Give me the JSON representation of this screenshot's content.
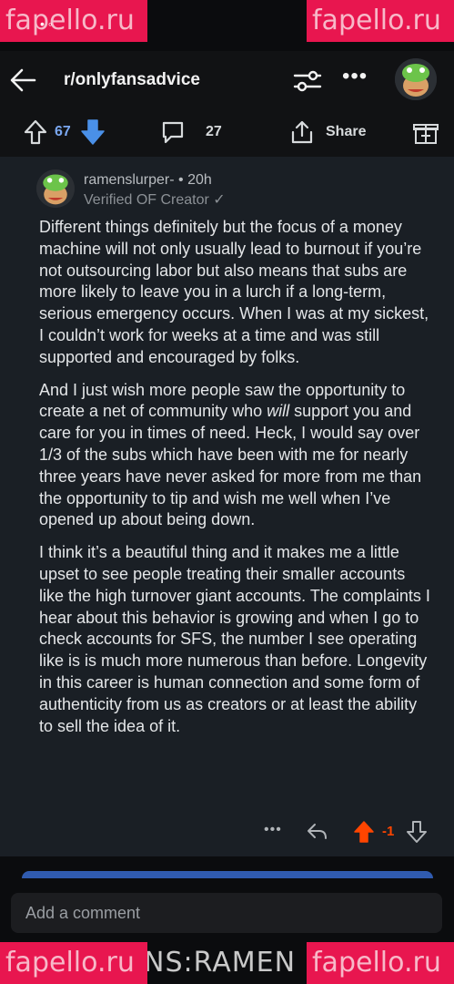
{
  "watermark": "fapello.ru",
  "header": {
    "subreddit": "r/onlyfansadvice"
  },
  "actions": {
    "upvotes": "67",
    "comments": "27",
    "share_label": "Share"
  },
  "comment": {
    "username": "ramenslurper-",
    "time": "• 20h",
    "flair": "Verified OF Creator ✓",
    "paragraphs": [
      "Different things definitely but the focus of a money machine will not only usually lead to burnout if you’re not outsourcing labor but also means that subs are more likely to leave you in a lurch if a long-term, serious emergency occurs. When I was at my sickest, I couldn’t work for weeks at a time and was still supported and encouraged by folks.",
      "I think it’s a beautiful thing and it makes me a little upset to see people treating their smaller accounts like the high turnover giant accounts. The complaints I hear about this behavior is growing and when I go to check accounts for SFS, the number I see operating like is is much more numerous than before. Longevity in this career is human connection and some form of authenticity from us as creators or at least the ability to sell the idea of it."
    ],
    "p2_before": "And I just wish more people saw the opportunity to create a net of community who ",
    "p2_em": "will",
    "p2_after": " support you and care for you in times of need. Heck, I would say over 1/3 of the subs which have been with me for nearly three years have never asked for more from me than the opportunity to tip and wish me well when I’ve opened up about being down.",
    "score": "-1"
  },
  "composer": {
    "placeholder": "Add a comment"
  },
  "bottom_text": "NS:RAMEN",
  "colors": {
    "upvote_blue": "#4a90e8",
    "downvote_orange": "#ff4500",
    "background": "#1a1f25"
  },
  "icons": [
    "back-arrow-icon",
    "filter-icon",
    "more-icon",
    "upvote-icon",
    "downvote-icon",
    "comment-icon",
    "share-icon",
    "award-icon",
    "reply-icon"
  ]
}
